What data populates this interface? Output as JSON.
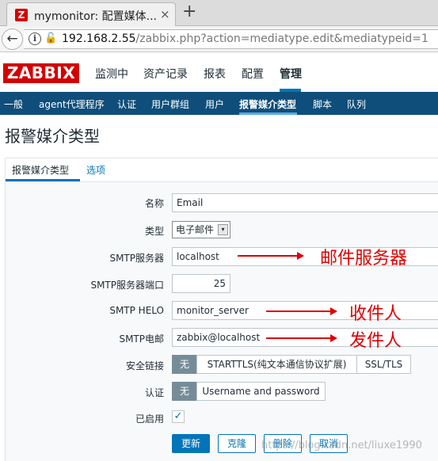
{
  "browser": {
    "tab_title": "mymonitor: 配置媒体...",
    "tab_favicon": "Z",
    "close_glyph": "×",
    "newtab_glyph": "+",
    "url_host": "192.168.2.55",
    "url_path": "/zabbix.php?action=mediatype.edit&mediatypeid=1"
  },
  "logo": "ZABBIX",
  "topnav": [
    "监测中",
    "资产记录",
    "报表",
    "配置",
    "管理"
  ],
  "subnav": [
    "一般",
    "agent代理程序",
    "认证",
    "用户群组",
    "用户",
    "报警媒介类型",
    "脚本",
    "队列"
  ],
  "page_title": "报警媒介类型",
  "form_tabs": [
    "报警媒介类型",
    "选项"
  ],
  "form": {
    "name_label": "名称",
    "name_value": "Email",
    "type_label": "类型",
    "type_value": "电子邮件",
    "smtp_server_label": "SMTP服务器",
    "smtp_server_value": "localhost",
    "smtp_port_label": "SMTP服务器端口",
    "smtp_port_value": "25",
    "smtp_helo_label": "SMTP HELO",
    "smtp_helo_value": "monitor_server",
    "smtp_email_label": "SMTP电邮",
    "smtp_email_value": "zabbix@localhost",
    "security_label": "安全链接",
    "security_options": [
      "无",
      "STARTTLS(纯文本通信协议扩展)",
      "SSL/TLS"
    ],
    "auth_label": "认证",
    "auth_options": [
      "无",
      "Username and password"
    ],
    "enabled_label": "已启用",
    "enabled": true,
    "check_glyph": "✓"
  },
  "buttons": {
    "update": "更新",
    "clone": "克隆",
    "delete": "删除",
    "cancel": "取消"
  },
  "annotations": {
    "mail_server": "邮件服务器",
    "recipient": "收件人",
    "sender": "发件人"
  },
  "watermark": "https://blog.csdn.net/liuxe1990",
  "colors": {
    "brand_red": "#d40000",
    "nav_blue": "#0f4e7a",
    "accent_blue": "#0275b8",
    "annotation_red": "#e00000"
  }
}
